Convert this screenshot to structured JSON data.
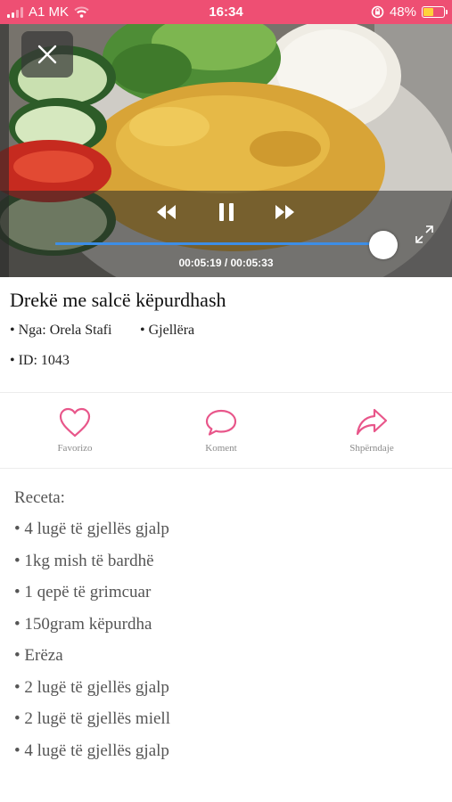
{
  "status_bar": {
    "carrier": "A1 MK",
    "time": "16:34",
    "battery": "48%",
    "battery_level": 0.48,
    "battery_color": "#ffd23a",
    "background_color": "#ee4f73",
    "icons": [
      "signal-icon",
      "wifi-icon",
      "orientation-lock-icon",
      "battery-icon"
    ]
  },
  "video": {
    "time_readout": "00:05:19 / 00:05:33",
    "progress": 0.958,
    "progress_color": "#3d8ee6",
    "icons": [
      "close-icon",
      "rewind-icon",
      "pause-icon",
      "fast-forward-icon",
      "fullscreen-icon"
    ]
  },
  "recipe_header": {
    "title": "Drekë me salcë këpurdhash",
    "author": "• Nga: Orela Stafi",
    "category": "• Gjellëra",
    "id": "• ID: 1043"
  },
  "actions": {
    "accent_color": "#e8568a",
    "items": [
      {
        "label": "Favorizo",
        "icon": "heart-icon"
      },
      {
        "label": "Koment",
        "icon": "comment-icon"
      },
      {
        "label": "Shpërndaje",
        "icon": "share-icon"
      }
    ]
  },
  "recipe": {
    "title": "Receta:",
    "lines": [
      "• 4 lugë të gjellës gjalp",
      "• 1kg mish të bardhë",
      "• 1 qepë të grimcuar",
      "• 150gram këpurdha",
      "• Erëza",
      "• 2 lugë të gjellës gjalp",
      "• 2 lugë të gjellës miell",
      "• 4 lugë të gjellës gjalp"
    ]
  }
}
